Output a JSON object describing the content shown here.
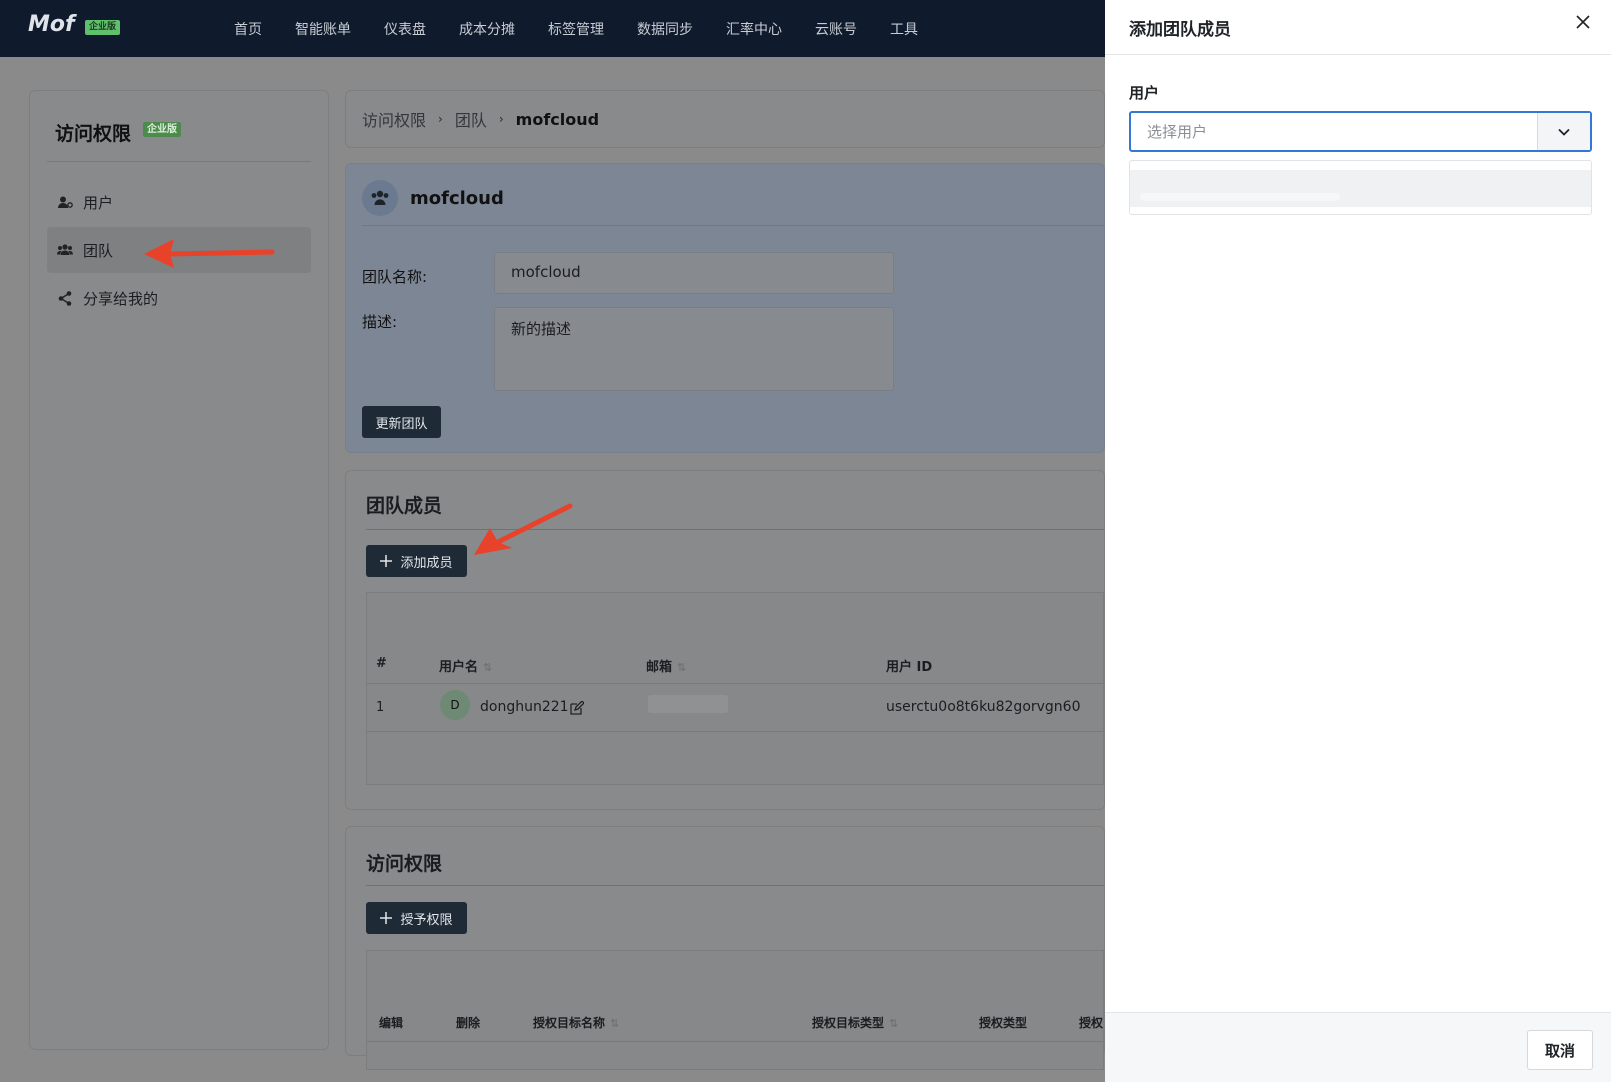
{
  "app": {
    "logo": "Mof",
    "edition_badge": "企业版"
  },
  "nav": {
    "items": [
      "首页",
      "智能账单",
      "仪表盘",
      "成本分摊",
      "标签管理",
      "数据同步",
      "汇率中心",
      "云账号",
      "工具"
    ]
  },
  "sidebar": {
    "title": "访问权限",
    "badge": "企业版",
    "items": [
      {
        "label": "用户",
        "icon": "user-icon"
      },
      {
        "label": "团队",
        "icon": "team-icon"
      },
      {
        "label": "分享给我的",
        "icon": "share-icon"
      }
    ]
  },
  "breadcrumb": {
    "items": [
      "访问权限",
      "团队",
      "mofcloud"
    ],
    "separator": "›"
  },
  "team": {
    "name": "mofcloud",
    "name_label": "团队名称:",
    "name_value": "mofcloud",
    "desc_label": "描述:",
    "desc_value": "新的描述",
    "update_button": "更新团队"
  },
  "members": {
    "title": "团队成员",
    "add_button": "添加成员",
    "columns": [
      "#",
      "用户名",
      "邮箱",
      "用户 ID"
    ],
    "rows": [
      {
        "index": "1",
        "avatar": "D",
        "username": "donghun221",
        "email": "",
        "user_id": "userctu0o8t6ku82gorvgn60"
      }
    ]
  },
  "permissions": {
    "title": "访问权限",
    "grant_button": "授予权限",
    "columns": [
      "编辑",
      "删除",
      "授权目标名称",
      "授权目标类型",
      "授权类型",
      "授权"
    ]
  },
  "drawer": {
    "title": "添加团队成员",
    "user_label": "用户",
    "select_placeholder": "选择用户",
    "cancel_button": "取消"
  },
  "colors": {
    "nav_bg": "#0f1a2c",
    "accent": "#3577d4",
    "annotation_arrow": "#e8422b",
    "dark_button": "#1f2a37"
  }
}
